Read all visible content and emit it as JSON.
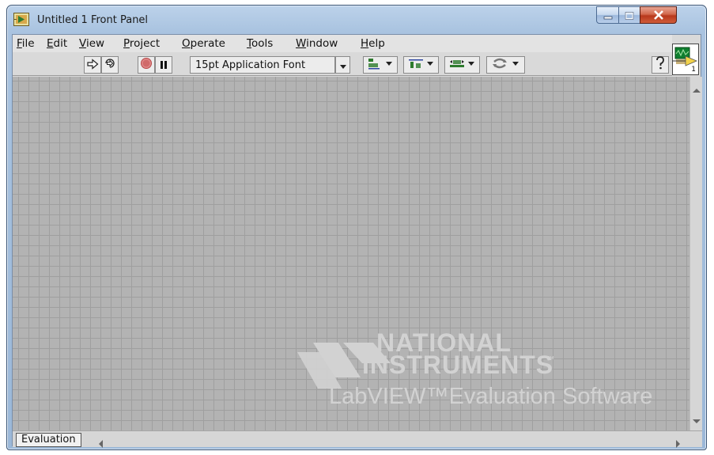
{
  "window": {
    "title": "Untitled 1 Front Panel"
  },
  "menu": {
    "items": [
      {
        "label": "File"
      },
      {
        "label": "Edit"
      },
      {
        "label": "View"
      },
      {
        "label": "Project"
      },
      {
        "label": "Operate"
      },
      {
        "label": "Tools"
      },
      {
        "label": "Window"
      },
      {
        "label": "Help"
      }
    ]
  },
  "toolbar": {
    "font_select_value": "15pt Application Font",
    "icons": [
      "run-arrow-icon",
      "run-continuously-icon",
      "abort-icon",
      "pause-icon",
      "align-objects-icon",
      "distribute-objects-icon",
      "resize-objects-icon",
      "reorder-icon",
      "context-help-icon"
    ]
  },
  "vi_icon": {
    "number": "1"
  },
  "watermark": {
    "line1": "NATIONAL",
    "line2": "INSTRUMENTS",
    "tm": "™",
    "line3": "LabVIEW™Evaluation Software"
  },
  "bottom": {
    "tab_label": "Evaluation"
  },
  "colors": {
    "canvas": "#b3b3b3",
    "grid": "#9f9f9f",
    "titlebar": "#a9c3e0",
    "close_button": "#c7442a"
  }
}
